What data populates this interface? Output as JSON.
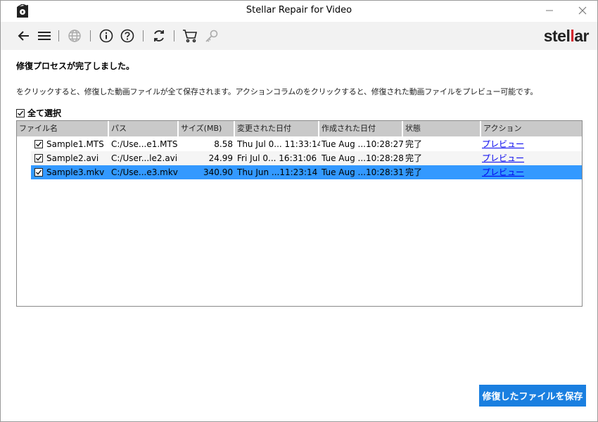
{
  "app": {
    "title": "Stellar Repair for Video",
    "logo_part1": "stel",
    "logo_part2": "l",
    "logo_part3": "ar"
  },
  "toolbar": {
    "icons": [
      "back-icon",
      "menu-icon",
      "globe-icon",
      "info-icon",
      "help-icon",
      "refresh-icon",
      "cart-icon",
      "key-icon"
    ]
  },
  "main": {
    "heading": "修復プロセスが完了しました。",
    "description": "をクリックすると、修復した動画ファイルが全て保存されます。アクションコラムのをクリックすると、修復された動画ファイルをプレビュー可能です。",
    "select_all_label": "全て選択"
  },
  "table": {
    "columns": [
      "ファイル名",
      "パス",
      "サイズ(MB)",
      "変更された日付",
      "作成された日付",
      "状態",
      "アクション"
    ],
    "rows": [
      {
        "name": "Sample1.MTS",
        "path": "C:/Use...e1.MTS",
        "size": "8.58",
        "modified": "Thu Jul 0... 11:33:14",
        "created": "Tue Aug ...10:28:27",
        "status": "完了",
        "action": "プレビュー",
        "checked": true,
        "selected": false
      },
      {
        "name": "Sample2.avi",
        "path": "C:/User...le2.avi",
        "size": "24.99",
        "modified": "Fri Jul 0... 16:31:06",
        "created": "Tue Aug ...10:28:28",
        "status": "完了",
        "action": "プレビュー",
        "checked": true,
        "selected": false
      },
      {
        "name": "Sample3.mkv",
        "path": "C:/Use...e3.mkv",
        "size": "340.90",
        "modified": "Thu Jun ...11:23:14",
        "created": "Tue Aug ...10:28:31",
        "status": "完了",
        "action": "プレビュー",
        "checked": true,
        "selected": true
      }
    ]
  },
  "footer": {
    "save_label": "修復したファイルを保存"
  },
  "colors": {
    "accent": "#1a7fe0",
    "selection": "#3399ff",
    "logo_red": "#d3282e"
  }
}
